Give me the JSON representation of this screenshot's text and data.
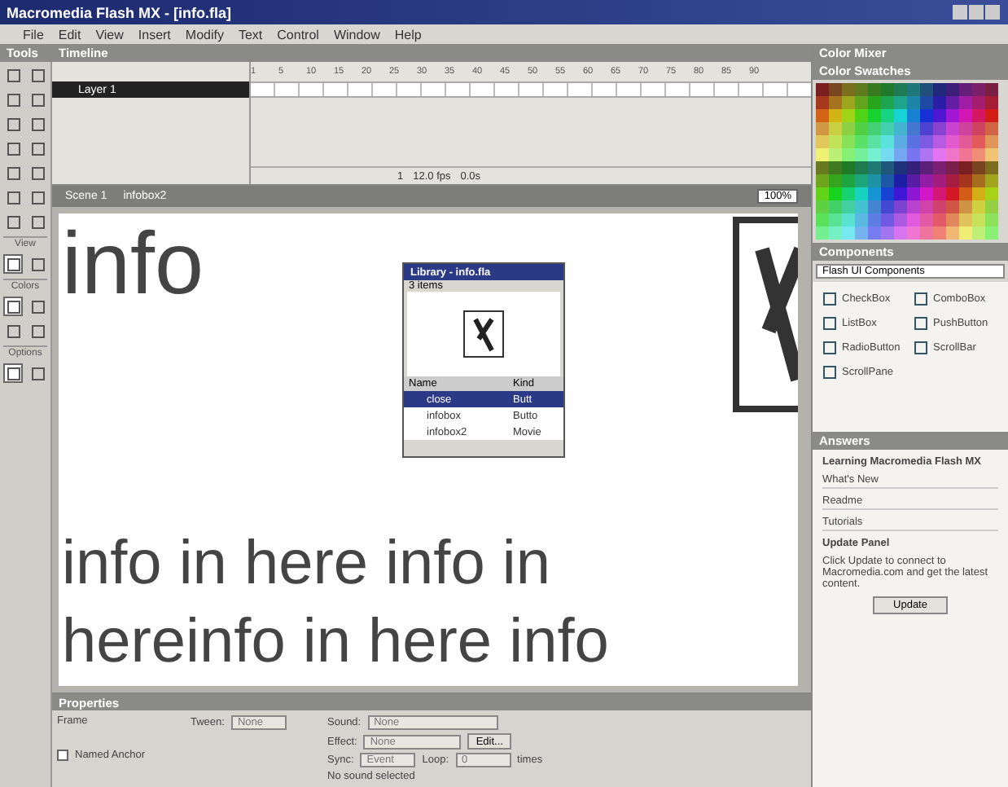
{
  "window": {
    "title": "Macromedia Flash MX - [info.fla]"
  },
  "menu": [
    "File",
    "Edit",
    "View",
    "Insert",
    "Modify",
    "Text",
    "Control",
    "Window",
    "Help"
  ],
  "tools": {
    "title": "Tools",
    "sections": [
      "View",
      "Colors",
      "Options"
    ]
  },
  "timeline": {
    "title": "Timeline",
    "layers": [
      {
        "name": "Layer 1",
        "selected": true
      }
    ],
    "ruler": [
      "1",
      "5",
      "10",
      "15",
      "20",
      "25",
      "30",
      "35",
      "40",
      "45",
      "50",
      "55",
      "60",
      "65",
      "70",
      "75",
      "80",
      "85",
      "90"
    ],
    "frame": "1",
    "fps": "12.0 fps",
    "time": "0.0s"
  },
  "scene_bar": {
    "items": [
      "Scene 1",
      "infobox2"
    ],
    "zoom": "100%"
  },
  "stage": {
    "heading": "info",
    "lines": [
      "info in here info in",
      "hereinfo in here info"
    ]
  },
  "library": {
    "title": "Library - info.fla",
    "count": "3 items",
    "columns": [
      "Name",
      "Kind"
    ],
    "items": [
      {
        "name": "close",
        "kind": "Butt",
        "selected": true
      },
      {
        "name": "infobox",
        "kind": "Butto",
        "selected": false
      },
      {
        "name": "infobox2",
        "kind": "Movie",
        "selected": false
      }
    ]
  },
  "panels": {
    "color_mixer": "Color Mixer",
    "color_swatches": "Color Swatches",
    "components": "Components",
    "component_set": "Flash UI Components",
    "component_items": [
      "CheckBox",
      "ComboBox",
      "ListBox",
      "PushButton",
      "RadioButton",
      "ScrollBar",
      "ScrollPane"
    ],
    "answers": "Answers",
    "answers_heading": "Learning Macromedia Flash MX",
    "answers_links": [
      "What's New",
      "Readme",
      "Tutorials"
    ],
    "update_title": "Update Panel",
    "update_text": "Click Update to connect to Macromedia.com and get the latest content.",
    "update_button": "Update"
  },
  "properties": {
    "title": "Properties",
    "frame_label": "Frame",
    "tween_label": "Tween:",
    "tween_value": "None",
    "sound_label": "Sound:",
    "sound_value": "None",
    "effect_label": "Effect:",
    "effect_value": "None",
    "edit_button": "Edit...",
    "sync_label": "Sync:",
    "sync_value": "Event",
    "loop_label": "Loop:",
    "loop_value": "0",
    "times": "times",
    "status": "No sound selected",
    "anchor": "Named Anchor",
    "anchor_checked": false
  }
}
